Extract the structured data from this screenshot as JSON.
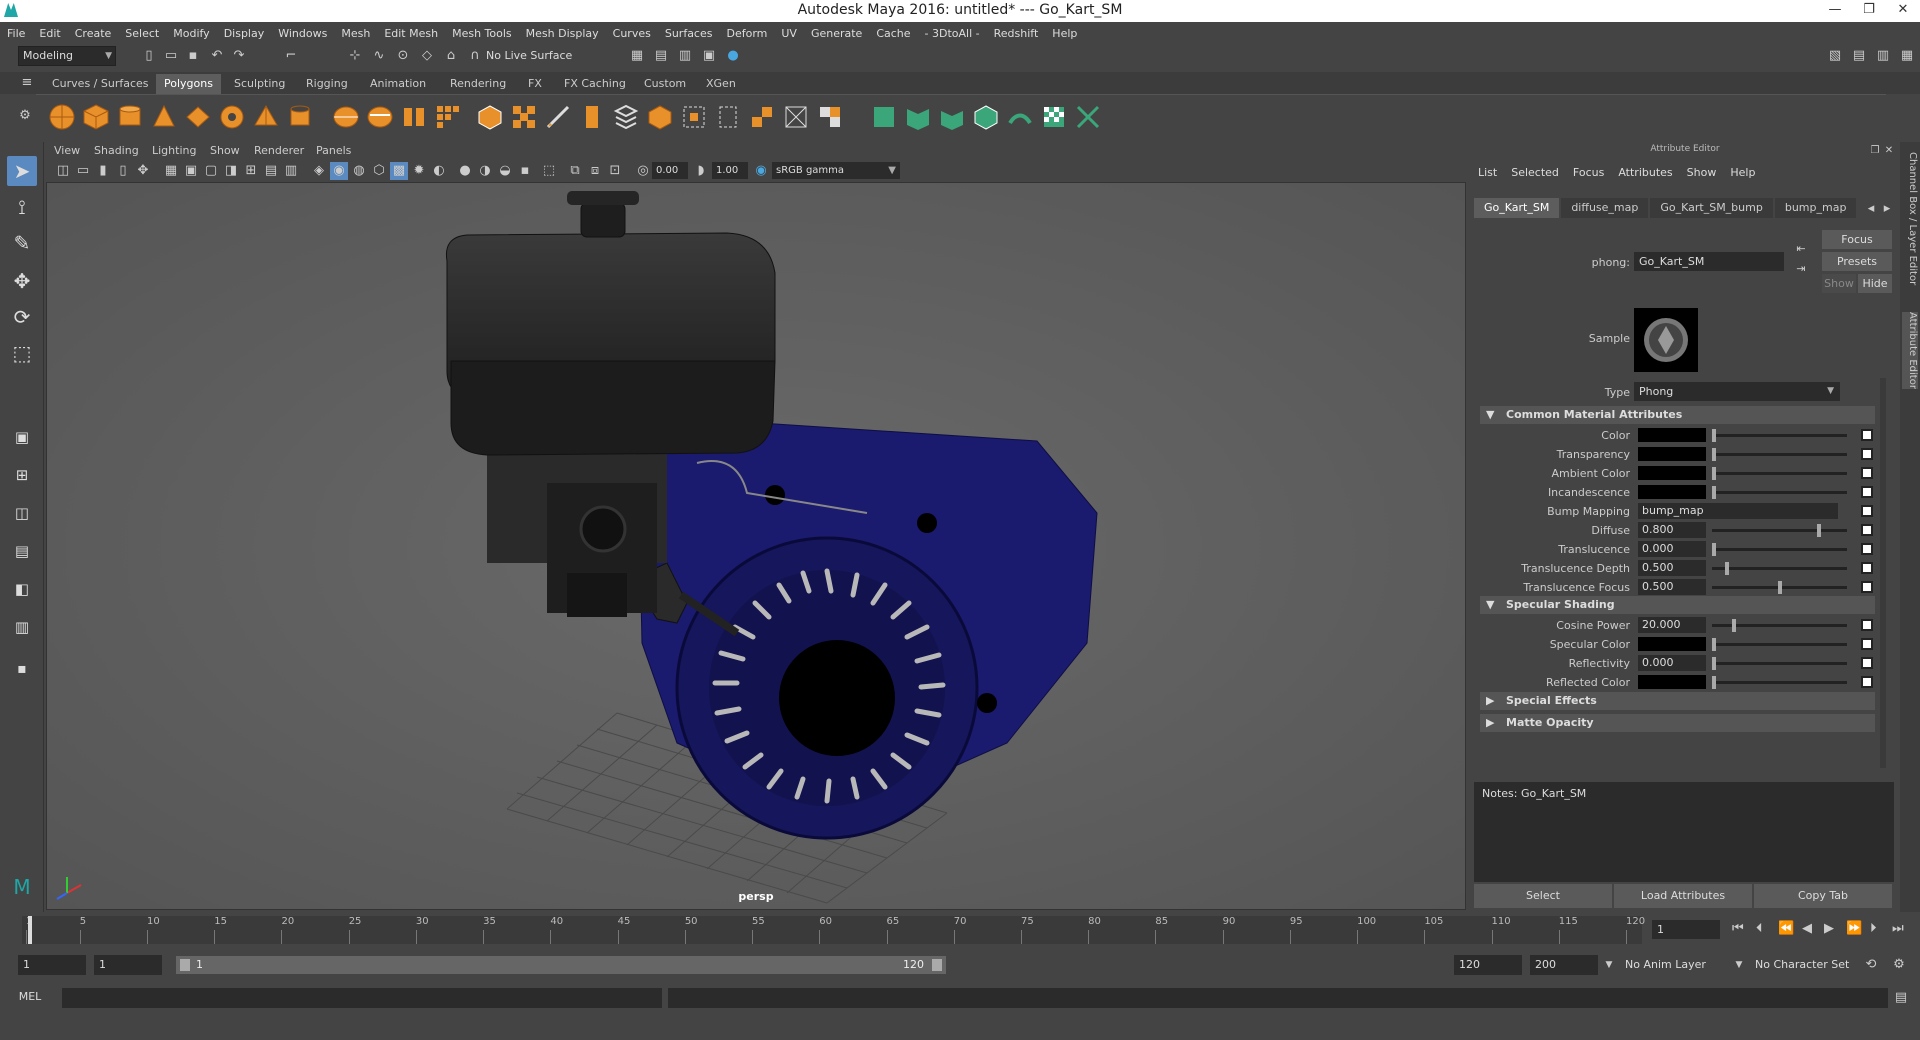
{
  "window": {
    "title": "Autodesk Maya 2016: untitled*   ---   Go_Kart_SM",
    "controls": [
      "—",
      "❐",
      "✕"
    ]
  },
  "menubar": [
    "File",
    "Edit",
    "Create",
    "Select",
    "Modify",
    "Display",
    "Windows",
    "Mesh",
    "Edit Mesh",
    "Mesh Tools",
    "Mesh Display",
    "Curves",
    "Surfaces",
    "Deform",
    "UV",
    "Generate",
    "Cache",
    "- 3DtoAll -",
    "Redshift",
    "Help"
  ],
  "statusline": {
    "menuset": "Modeling",
    "live_surface": "No Live Surface"
  },
  "shelf": {
    "tabs": [
      "Curves / Surfaces",
      "Polygons",
      "Sculpting",
      "Rigging",
      "Animation",
      "Rendering",
      "FX",
      "FX Caching",
      "Custom",
      "XGen"
    ],
    "active_tab": "Polygons",
    "colors": {
      "poly": "#e8902a",
      "uv": "#3aa67a"
    }
  },
  "toolbox": {
    "tools": [
      "select-tool",
      "lasso-tool",
      "paint-select-tool",
      "move-tool",
      "rotate-tool",
      "scale-tool"
    ]
  },
  "viewport": {
    "menu": [
      "View",
      "Shading",
      "Lighting",
      "Show",
      "Renderer",
      "Panels"
    ],
    "exposure": "0.00",
    "gamma": "1.00",
    "color_space": "sRGB gamma",
    "camera": "persp"
  },
  "attribute_editor": {
    "title": "Attribute Editor",
    "menu": [
      "List",
      "Selected",
      "Focus",
      "Attributes",
      "Show",
      "Help"
    ],
    "tabs": [
      "Go_Kart_SM",
      "diffuse_map",
      "Go_Kart_SM_bump",
      "bump_map"
    ],
    "active_tab": "Go_Kart_SM",
    "node_label": "phong:",
    "node_name": "Go_Kart_SM",
    "buttons": {
      "focus": "Focus",
      "presets": "Presets",
      "show": "Show",
      "hide": "Hide"
    },
    "sample_label": "Sample",
    "type_label": "Type",
    "type_value": "Phong",
    "common_section": "Common Material Attributes",
    "common": [
      {
        "label": "Color",
        "kind": "swatch",
        "slider": 0.0
      },
      {
        "label": "Transparency",
        "kind": "swatch",
        "slider": 0.0
      },
      {
        "label": "Ambient Color",
        "kind": "swatch",
        "slider": 0.0
      },
      {
        "label": "Incandescence",
        "kind": "swatch",
        "slider": 0.0
      },
      {
        "label": "Bump Mapping",
        "kind": "text",
        "value": "bump_map"
      },
      {
        "label": "Diffuse",
        "kind": "value",
        "value": "0.800",
        "slider": 0.8
      },
      {
        "label": "Translucence",
        "kind": "value",
        "value": "0.000",
        "slider": 0.0
      },
      {
        "label": "Translucence Depth",
        "kind": "value",
        "value": "0.500",
        "slider": 0.1
      },
      {
        "label": "Translucence Focus",
        "kind": "value",
        "value": "0.500",
        "slider": 0.5
      }
    ],
    "specular_section": "Specular Shading",
    "specular": [
      {
        "label": "Cosine Power",
        "kind": "value",
        "value": "20.000",
        "slider": 0.15
      },
      {
        "label": "Specular Color",
        "kind": "swatch",
        "slider": 0.0
      },
      {
        "label": "Reflectivity",
        "kind": "value",
        "value": "0.000",
        "slider": 0.0
      },
      {
        "label": "Reflected Color",
        "kind": "swatch",
        "slider": 0.0
      }
    ],
    "collapsed_sections": [
      "Special Effects",
      "Matte Opacity"
    ],
    "notes_label": "Notes:  Go_Kart_SM",
    "bottom_buttons": [
      "Select",
      "Load Attributes",
      "Copy Tab"
    ]
  },
  "side_tabs": [
    "Channel Box / Layer Editor",
    "Attribute Editor"
  ],
  "timeline": {
    "ticks": [
      "1",
      "5",
      "10",
      "15",
      "20",
      "25",
      "30",
      "35",
      "40",
      "45",
      "50",
      "55",
      "60",
      "65",
      "70",
      "75",
      "80",
      "85",
      "90",
      "95",
      "100",
      "105",
      "110",
      "115",
      "120"
    ],
    "current_frame": "1"
  },
  "range": {
    "start": "1",
    "anim_start": "1",
    "range_start_label": "1",
    "range_end_label": "120",
    "anim_end": "120",
    "end": "200",
    "anim_layer": "No Anim Layer",
    "char_set": "No Character Set"
  },
  "command": {
    "label": "MEL"
  }
}
